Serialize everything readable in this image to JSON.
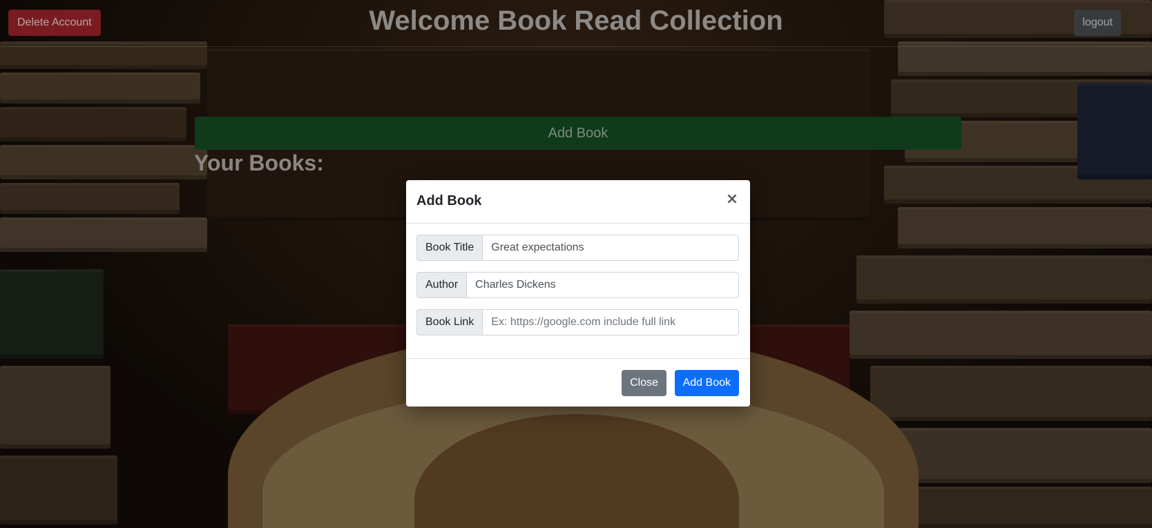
{
  "header": {
    "title": "Welcome Book Read Collection",
    "delete_account_label": "Delete Account",
    "logout_label": "logout"
  },
  "main": {
    "add_book_bar_label": "Add Book",
    "section_heading": "Your Books:"
  },
  "modal": {
    "title": "Add Book",
    "close_symbol": "×",
    "fields": [
      {
        "label": "Book Title",
        "value": "Great expectations",
        "placeholder": ""
      },
      {
        "label": "Author",
        "value": "Charles Dickens",
        "placeholder": ""
      },
      {
        "label": "Book Link",
        "value": "",
        "placeholder": "Ex: https://google.com include full link"
      }
    ],
    "close_label": "Close",
    "submit_label": "Add Book"
  },
  "colors": {
    "delete_button": "#dc3545",
    "add_book_bar": "#198754",
    "primary": "#0d6efd",
    "secondary": "#6c757d"
  },
  "background": {
    "description_icon": "bookshelf-background"
  }
}
